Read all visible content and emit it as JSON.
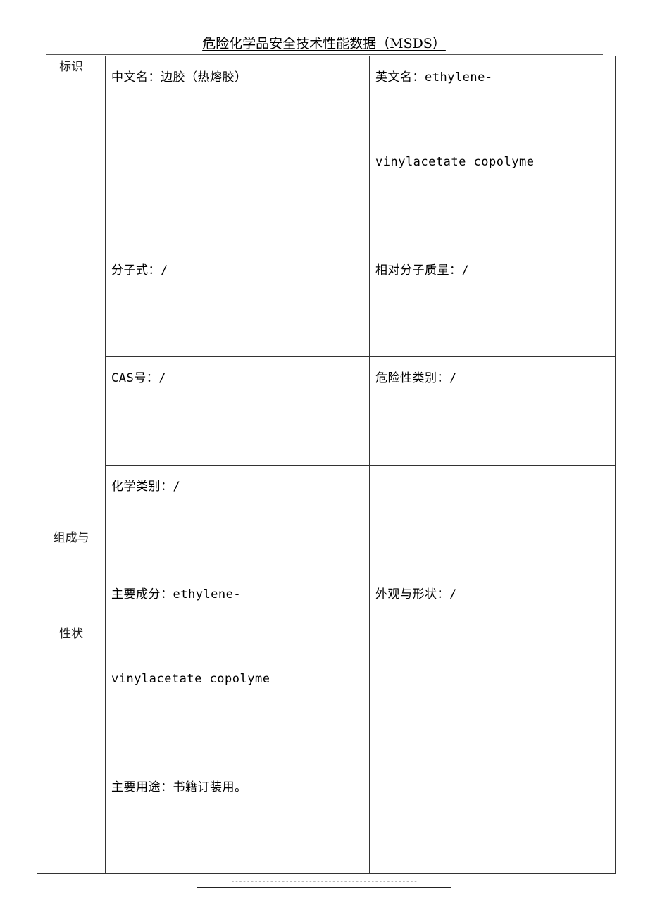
{
  "document": {
    "title": "危险化学品安全技术性能数据（MSDS）",
    "footer": "------------------------------------------------"
  },
  "sections": [
    {
      "label": "标识",
      "rows": [
        {
          "left": {
            "line1": "中文名：边胶（热熔胶）"
          },
          "right": {
            "line1": "英文名：ethylene-",
            "line2": "vinylacetate copolyme"
          }
        },
        {
          "left": {
            "line1": "分子式：/"
          },
          "right": {
            "line1": "相对分子质量：/"
          }
        },
        {
          "left": {
            "line1": "CAS号：/"
          },
          "right": {
            "line1": "危险性类别：/"
          }
        },
        {
          "left": {
            "line1": "化学类别：/"
          },
          "right": {
            "line1": ""
          }
        }
      ]
    },
    {
      "label_line1": "组成与",
      "label_line2": "性状",
      "rows": [
        {
          "left": {
            "line1": "主要成分：ethylene-",
            "line2": "vinylacetate copolyme"
          },
          "right": {
            "line1": "外观与形状：/"
          }
        },
        {
          "left": {
            "line1": "主要用途：书籍订装用。"
          },
          "right": {
            "line1": ""
          }
        }
      ]
    }
  ]
}
